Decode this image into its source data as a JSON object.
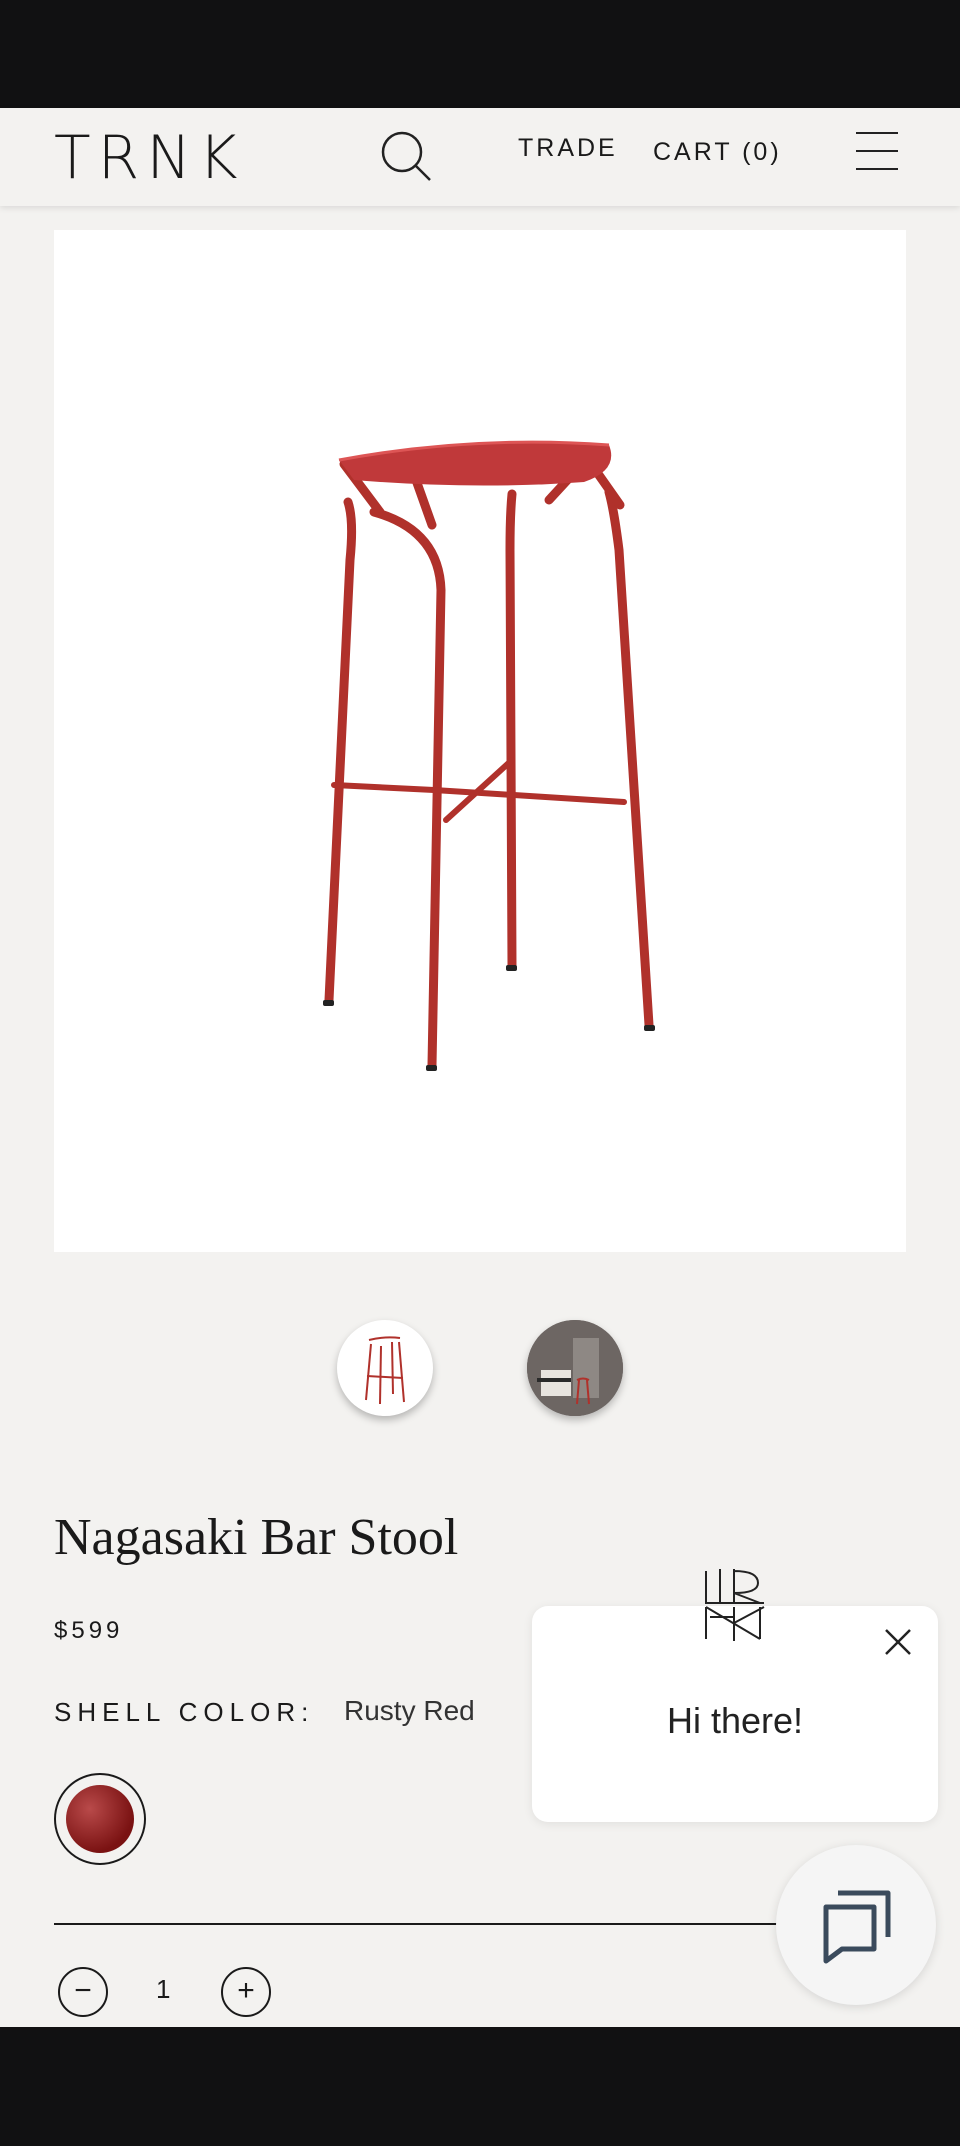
{
  "header": {
    "logo": "TRNK",
    "trade_label": "TRADE",
    "cart_label": "CART (0)",
    "search_icon": "search-icon",
    "menu_icon": "hamburger-icon"
  },
  "product": {
    "title": "Nagasaki Bar Stool",
    "price": "$599",
    "shell_color_label": "SHELL COLOR:",
    "shell_color_value": "Rusty Red",
    "swatch_color": "#8b1a1a",
    "quantity": "1",
    "qty_minus": "−",
    "qty_plus": "+"
  },
  "chat": {
    "greeting": "Hi there!",
    "close_icon": "close-icon",
    "fab_icon": "chat-bubbles-icon"
  },
  "colors": {
    "background": "#f3f2f0",
    "accent_red": "#b0312b",
    "text": "#1a1a1a"
  }
}
